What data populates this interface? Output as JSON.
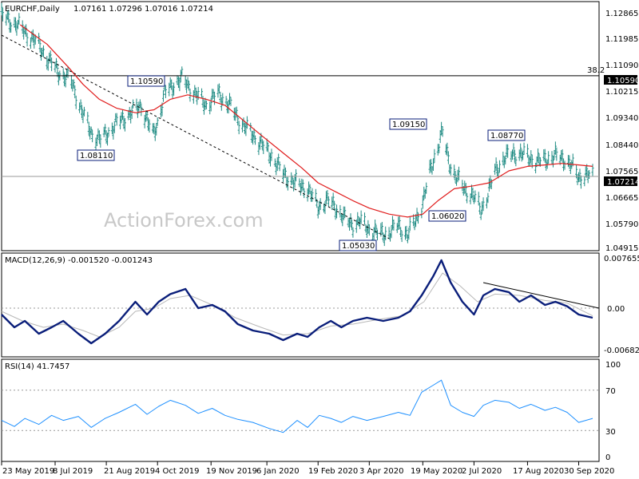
{
  "colors": {
    "price_bar": "#1d8a82",
    "ma": "#e01b1b",
    "macd": "#0a1e7a",
    "macd_signal": "#b8b8b8",
    "rsi": "#1e90ff",
    "grid": "#999999",
    "label_border": "#0a1e7a"
  },
  "chart_data": [
    {
      "type": "ohlc",
      "title": "EURCHF,Daily",
      "ohlc_text": "1.07161 1.07296 1.07016 1.07214",
      "watermark": "ActionForex.com",
      "ylim": [
        1.0475,
        1.1305
      ],
      "y_ticks": [
        "1.12865",
        "1.11985",
        "1.11090",
        "1.10215",
        "1.09340",
        "1.08440",
        "1.07565",
        "1.06665",
        "1.05790",
        "1.04915"
      ],
      "x_ticks": [
        "23 May 2019",
        "8 Jul 2019",
        "21 Aug 2019",
        "4 Oct 2019",
        "19 Nov 2019",
        "6 Jan 2020",
        "19 Feb 2020",
        "3 Apr 2020",
        "19 May 2020",
        "2 Jul 2020",
        "17 Aug 2020",
        "30 Sep 2020"
      ],
      "x_tick_values": [
        "2019-05-23",
        "2019-07-08",
        "2019-08-21",
        "2019-10-04",
        "2019-11-19",
        "2020-01-06",
        "2020-02-19",
        "2020-04-03",
        "2020-05-19",
        "2020-07-02",
        "2020-08-17",
        "2020-09-30"
      ],
      "current_price": "1.07214",
      "level_line": {
        "value": "1.10590",
        "label": "38.2"
      },
      "annotations": [
        "1.10590",
        "1.08110",
        "1.09150",
        "1.08770",
        "1.06020",
        "1.05030"
      ],
      "trendline": {
        "from": [
          "2019-05-23",
          1.1195
        ],
        "to": [
          "2020-04-20",
          1.0513
        ]
      },
      "close_path": [
        [
          "2019-05-23",
          1.126
        ],
        [
          "2019-06-05",
          1.123
        ],
        [
          "2019-06-20",
          1.118
        ],
        [
          "2019-07-01",
          1.112
        ],
        [
          "2019-07-10",
          1.1075
        ],
        [
          "2019-07-22",
          1.104
        ],
        [
          "2019-08-01",
          1.093
        ],
        [
          "2019-08-09",
          1.086
        ],
        [
          "2019-08-16",
          1.0845
        ],
        [
          "2019-08-23",
          1.087
        ],
        [
          "2019-08-30",
          1.09
        ],
        [
          "2019-09-10",
          1.093
        ],
        [
          "2019-09-20",
          1.096
        ],
        [
          "2019-09-30",
          1.086
        ],
        [
          "2019-10-04",
          1.09
        ],
        [
          "2019-10-10",
          1.1
        ],
        [
          "2019-10-18",
          1.103
        ],
        [
          "2019-10-25",
          1.105
        ],
        [
          "2019-11-05",
          1.1
        ],
        [
          "2019-11-15",
          1.096
        ],
        [
          "2019-11-25",
          1.1
        ],
        [
          "2019-12-05",
          1.096
        ],
        [
          "2019-12-15",
          1.09
        ],
        [
          "2019-12-30",
          1.084
        ],
        [
          "2020-01-10",
          1.079
        ],
        [
          "2020-01-20",
          1.073
        ],
        [
          "2020-01-30",
          1.07
        ],
        [
          "2020-02-10",
          1.068
        ],
        [
          "2020-02-19",
          1.062
        ],
        [
          "2020-02-28",
          1.064
        ],
        [
          "2020-03-05",
          1.062
        ],
        [
          "2020-03-12",
          1.058
        ],
        [
          "2020-03-20",
          1.056
        ],
        [
          "2020-03-26",
          1.057
        ],
        [
          "2020-04-03",
          1.0545
        ],
        [
          "2020-04-10",
          1.053
        ],
        [
          "2020-04-20",
          1.053
        ],
        [
          "2020-04-28",
          1.056
        ],
        [
          "2020-05-06",
          1.052
        ],
        [
          "2020-05-12",
          1.057
        ],
        [
          "2020-05-19",
          1.063
        ],
        [
          "2020-05-26",
          1.075
        ],
        [
          "2020-06-01",
          1.082
        ],
        [
          "2020-06-05",
          1.087
        ],
        [
          "2020-06-10",
          1.078
        ],
        [
          "2020-06-16",
          1.072
        ],
        [
          "2020-06-24",
          1.068
        ],
        [
          "2020-07-02",
          1.065
        ],
        [
          "2020-07-08",
          1.061
        ],
        [
          "2020-07-14",
          1.066
        ],
        [
          "2020-07-20",
          1.074
        ],
        [
          "2020-07-28",
          1.078
        ],
        [
          "2020-08-05",
          1.08
        ],
        [
          "2020-08-17",
          1.079
        ],
        [
          "2020-08-25",
          1.077
        ],
        [
          "2020-09-03",
          1.078
        ],
        [
          "2020-09-10",
          1.079
        ],
        [
          "2020-09-18",
          1.078
        ],
        [
          "2020-09-25",
          1.075
        ],
        [
          "2020-09-30",
          1.072
        ],
        [
          "2020-10-06",
          1.0725
        ],
        [
          "2020-10-12",
          1.0721
        ]
      ],
      "ma_path": [
        [
          "2019-06-08",
          1.123
        ],
        [
          "2019-07-01",
          1.1165
        ],
        [
          "2019-07-20",
          1.1085
        ],
        [
          "2019-08-01",
          1.103
        ],
        [
          "2019-08-15",
          1.098
        ],
        [
          "2019-08-30",
          1.095
        ],
        [
          "2019-09-15",
          1.0935
        ],
        [
          "2019-10-01",
          1.0945
        ],
        [
          "2019-10-15",
          1.098
        ],
        [
          "2019-10-30",
          1.0995
        ],
        [
          "2019-11-15",
          1.098
        ],
        [
          "2019-12-01",
          1.096
        ],
        [
          "2019-12-15",
          1.0915
        ],
        [
          "2020-01-01",
          1.086
        ],
        [
          "2020-01-20",
          1.08
        ],
        [
          "2020-02-05",
          1.075
        ],
        [
          "2020-02-19",
          1.07
        ],
        [
          "2020-03-05",
          1.067
        ],
        [
          "2020-03-20",
          1.064
        ],
        [
          "2020-04-03",
          1.0615
        ],
        [
          "2020-04-20",
          1.0595
        ],
        [
          "2020-05-06",
          1.0585
        ],
        [
          "2020-05-19",
          1.0595
        ],
        [
          "2020-06-01",
          1.064
        ],
        [
          "2020-06-15",
          1.068
        ],
        [
          "2020-07-02",
          1.069
        ],
        [
          "2020-07-15",
          1.07
        ],
        [
          "2020-08-01",
          1.074
        ],
        [
          "2020-08-17",
          1.0755
        ],
        [
          "2020-09-01",
          1.076
        ],
        [
          "2020-09-15",
          1.0765
        ],
        [
          "2020-09-30",
          1.076
        ],
        [
          "2020-10-12",
          1.0755
        ]
      ]
    },
    {
      "type": "line",
      "title": "MACD(12,26,9) -0.001520 -0.001243",
      "ylim": [
        -0.0075,
        0.0085
      ],
      "y_ticks": [
        "0.007655",
        "0.00",
        "-0.006822"
      ],
      "zero_label": "0.00",
      "trendline": {
        "from": [
          "2020-07-10",
          0.004
        ],
        "to": [
          "2020-10-12",
          0.0
        ]
      },
      "series": [
        {
          "points": [
            [
              "2019-05-23",
              -0.001
            ],
            [
              "2019-06-03",
              -0.003
            ],
            [
              "2019-06-12",
              -0.002
            ],
            [
              "2019-06-24",
              -0.004
            ],
            [
              "2019-07-05",
              -0.003
            ],
            [
              "2019-07-15",
              -0.002
            ],
            [
              "2019-07-28",
              -0.004
            ],
            [
              "2019-08-08",
              -0.0055
            ],
            [
              "2019-08-20",
              -0.004
            ],
            [
              "2019-09-01",
              -0.002
            ],
            [
              "2019-09-15",
              0.001
            ],
            [
              "2019-09-25",
              -0.001
            ],
            [
              "2019-10-05",
              0.001
            ],
            [
              "2019-10-15",
              0.0022
            ],
            [
              "2019-10-28",
              0.003
            ],
            [
              "2019-11-08",
              0.0
            ],
            [
              "2019-11-20",
              0.0005
            ],
            [
              "2019-12-01",
              -0.0005
            ],
            [
              "2019-12-12",
              -0.0025
            ],
            [
              "2019-12-25",
              -0.0035
            ],
            [
              "2020-01-08",
              -0.004
            ],
            [
              "2020-01-20",
              -0.005
            ],
            [
              "2020-02-01",
              -0.004
            ],
            [
              "2020-02-10",
              -0.0045
            ],
            [
              "2020-02-20",
              -0.003
            ],
            [
              "2020-03-01",
              -0.002
            ],
            [
              "2020-03-10",
              -0.003
            ],
            [
              "2020-03-20",
              -0.002
            ],
            [
              "2020-04-01",
              -0.0015
            ],
            [
              "2020-04-15",
              -0.002
            ],
            [
              "2020-04-28",
              -0.0015
            ],
            [
              "2020-05-08",
              -0.0005
            ],
            [
              "2020-05-18",
              0.002
            ],
            [
              "2020-05-28",
              0.005
            ],
            [
              "2020-06-04",
              0.0075
            ],
            [
              "2020-06-12",
              0.004
            ],
            [
              "2020-06-22",
              0.001
            ],
            [
              "2020-07-02",
              -0.001
            ],
            [
              "2020-07-10",
              0.002
            ],
            [
              "2020-07-20",
              0.003
            ],
            [
              "2020-08-01",
              0.0025
            ],
            [
              "2020-08-10",
              0.001
            ],
            [
              "2020-08-20",
              0.002
            ],
            [
              "2020-09-01",
              0.0005
            ],
            [
              "2020-09-10",
              0.001
            ],
            [
              "2020-09-20",
              0.0003
            ],
            [
              "2020-09-30",
              -0.001
            ],
            [
              "2020-10-12",
              -0.0015
            ]
          ]
        },
        {
          "points": [
            [
              "2019-05-23",
              -0.0005
            ],
            [
              "2019-06-10",
              -0.002
            ],
            [
              "2019-06-28",
              -0.003
            ],
            [
              "2019-07-15",
              -0.0025
            ],
            [
              "2019-08-01",
              -0.0035
            ],
            [
              "2019-08-15",
              -0.0045
            ],
            [
              "2019-09-01",
              -0.003
            ],
            [
              "2019-09-15",
              -0.0005
            ],
            [
              "2019-10-01",
              0.0
            ],
            [
              "2019-10-15",
              0.0015
            ],
            [
              "2019-11-01",
              0.002
            ],
            [
              "2019-11-20",
              0.0005
            ],
            [
              "2019-12-10",
              -0.0015
            ],
            [
              "2020-01-01",
              -0.003
            ],
            [
              "2020-01-20",
              -0.0042
            ],
            [
              "2020-02-10",
              -0.004
            ],
            [
              "2020-03-01",
              -0.0028
            ],
            [
              "2020-03-20",
              -0.0025
            ],
            [
              "2020-04-10",
              -0.0018
            ],
            [
              "2020-05-01",
              -0.0012
            ],
            [
              "2020-05-20",
              0.001
            ],
            [
              "2020-06-05",
              0.0055
            ],
            [
              "2020-06-20",
              0.0035
            ],
            [
              "2020-07-05",
              0.001
            ],
            [
              "2020-07-20",
              0.0022
            ],
            [
              "2020-08-10",
              0.002
            ],
            [
              "2020-09-01",
              0.0012
            ],
            [
              "2020-09-20",
              0.0008
            ],
            [
              "2020-10-12",
              -0.0012
            ]
          ]
        }
      ]
    },
    {
      "type": "line",
      "title": "RSI(14) 41.7457",
      "ylim": [
        0,
        100
      ],
      "y_ticks": [
        "100",
        "70",
        "30",
        "0"
      ],
      "levels": [
        70,
        30
      ],
      "series": [
        {
          "points": [
            [
              "2019-05-23",
              40
            ],
            [
              "2019-06-03",
              34
            ],
            [
              "2019-06-12",
              42
            ],
            [
              "2019-06-24",
              36
            ],
            [
              "2019-07-05",
              45
            ],
            [
              "2019-07-15",
              40
            ],
            [
              "2019-07-28",
              44
            ],
            [
              "2019-08-08",
              33
            ],
            [
              "2019-08-20",
              42
            ],
            [
              "2019-09-01",
              48
            ],
            [
              "2019-09-15",
              56
            ],
            [
              "2019-09-25",
              46
            ],
            [
              "2019-10-05",
              54
            ],
            [
              "2019-10-15",
              60
            ],
            [
              "2019-10-28",
              55
            ],
            [
              "2019-11-08",
              47
            ],
            [
              "2019-11-20",
              52
            ],
            [
              "2019-12-01",
              45
            ],
            [
              "2019-12-12",
              41
            ],
            [
              "2019-12-25",
              38
            ],
            [
              "2020-01-08",
              32
            ],
            [
              "2020-01-20",
              28
            ],
            [
              "2020-02-01",
              40
            ],
            [
              "2020-02-10",
              33
            ],
            [
              "2020-02-20",
              45
            ],
            [
              "2020-03-01",
              42
            ],
            [
              "2020-03-10",
              38
            ],
            [
              "2020-03-20",
              44
            ],
            [
              "2020-04-01",
              40
            ],
            [
              "2020-04-15",
              44
            ],
            [
              "2020-04-28",
              48
            ],
            [
              "2020-05-08",
              45
            ],
            [
              "2020-05-18",
              68
            ],
            [
              "2020-05-28",
              75
            ],
            [
              "2020-06-04",
              80
            ],
            [
              "2020-06-12",
              55
            ],
            [
              "2020-06-22",
              48
            ],
            [
              "2020-07-02",
              44
            ],
            [
              "2020-07-10",
              55
            ],
            [
              "2020-07-20",
              60
            ],
            [
              "2020-08-01",
              58
            ],
            [
              "2020-08-10",
              52
            ],
            [
              "2020-08-20",
              56
            ],
            [
              "2020-09-01",
              50
            ],
            [
              "2020-09-10",
              53
            ],
            [
              "2020-09-20",
              48
            ],
            [
              "2020-09-30",
              38
            ],
            [
              "2020-10-12",
              42
            ]
          ]
        }
      ]
    }
  ]
}
